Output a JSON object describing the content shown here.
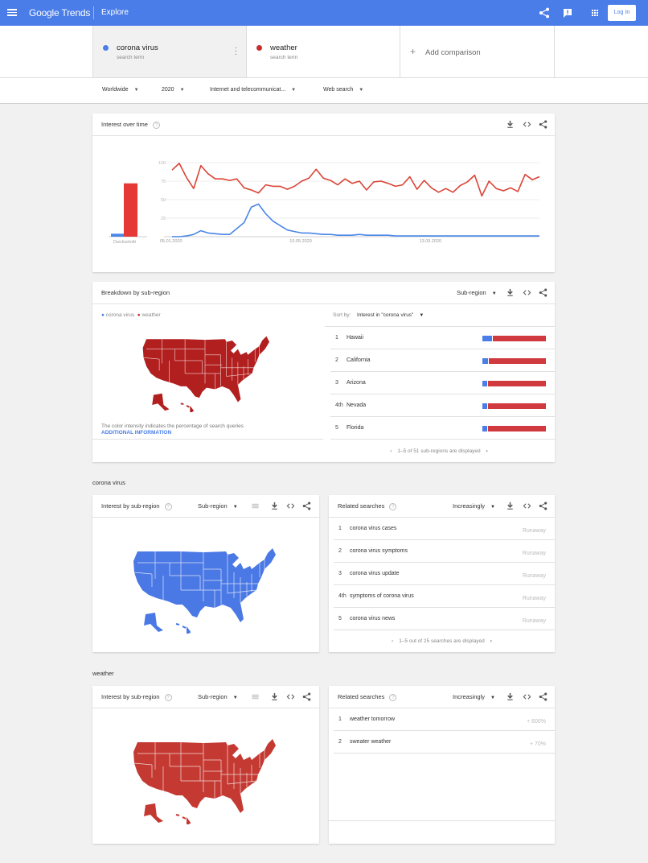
{
  "topbar": {
    "app_title": "Google Trends",
    "page": "Explore",
    "login_label": "Log In",
    "icons": [
      "menu-icon",
      "share-icon",
      "feedback-icon",
      "apps-icon"
    ]
  },
  "terms": [
    {
      "name": "corona virus",
      "sub": "search term",
      "color": "#4a7de8"
    },
    {
      "name": "weather",
      "sub": "search term",
      "color": "#c62e2e"
    }
  ],
  "add_comparison": "Add comparison",
  "filters": [
    {
      "label": "Worldwide"
    },
    {
      "label": "2020"
    },
    {
      "label": "Internet and telecommunicat..."
    },
    {
      "label": "Web search"
    }
  ],
  "interest_over_time": {
    "title": "Interest over time",
    "avg_label": "Durchschnitt"
  },
  "chart_data": {
    "type": "line",
    "title": "Interest over time",
    "ylim": [
      0,
      100
    ],
    "yticks": [
      "100",
      "75",
      "50",
      "25"
    ],
    "xticks": [
      "05.01.2020",
      "10.05.2020",
      "13.09.2020"
    ],
    "grid": true,
    "series": [
      {
        "name": "corona virus",
        "color": "#4a86e8",
        "values": [
          0,
          0,
          1,
          3,
          8,
          5,
          4,
          3,
          3,
          11,
          19,
          40,
          44,
          31,
          21,
          15,
          9,
          7,
          5,
          5,
          4,
          3,
          3,
          2,
          2,
          2,
          3,
          2,
          2,
          2,
          2,
          1,
          1,
          1,
          1,
          1,
          1,
          1,
          1,
          1,
          1,
          1,
          1,
          1,
          1,
          1,
          1,
          1,
          1,
          1,
          1,
          1
        ],
        "average": 4
      },
      {
        "name": "weather",
        "color": "#db4437",
        "values": [
          90,
          99,
          80,
          65,
          96,
          85,
          78,
          78,
          76,
          78,
          66,
          63,
          59,
          70,
          68,
          68,
          64,
          68,
          75,
          79,
          91,
          79,
          76,
          70,
          78,
          72,
          75,
          63,
          74,
          75,
          72,
          68,
          70,
          81,
          64,
          76,
          66,
          60,
          65,
          60,
          69,
          74,
          83,
          55,
          75,
          65,
          62,
          66,
          61,
          84,
          77,
          81
        ],
        "average": 72
      }
    ]
  },
  "breakdown": {
    "title": "Breakdown by sub-region",
    "select_label": "Sub-region",
    "legend": [
      "corona virus",
      "weather"
    ],
    "sort_label": "Sort by:",
    "sort_value": "Interest in \"corona virus\"",
    "note": "The color intensity indicates the percentage of search queries",
    "additional_info": "ADDITIONAL INFORMATION",
    "rows": [
      {
        "rank": "1",
        "name": "Hawaii",
        "corona_pct": 15,
        "weather_pct": 85
      },
      {
        "rank": "2",
        "name": "California",
        "corona_pct": 9,
        "weather_pct": 91
      },
      {
        "rank": "3",
        "name": "Arizona",
        "corona_pct": 8,
        "weather_pct": 92
      },
      {
        "rank": "4th",
        "name": "Nevada",
        "corona_pct": 8,
        "weather_pct": 92
      },
      {
        "rank": "5",
        "name": "Florida",
        "corona_pct": 8,
        "weather_pct": 92
      }
    ],
    "pager": "1–5 of 51 sub-regions are displayed"
  },
  "corona_section": {
    "label": "corona virus",
    "interest_title": "Interest by sub-region",
    "select_label": "Sub-region",
    "related_title": "Related searches",
    "related_select": "Increasingly",
    "related": [
      {
        "rank": "1",
        "query": "corona virus cases",
        "value": "Runaway"
      },
      {
        "rank": "2",
        "query": "corona virus symptoms",
        "value": "Runaway"
      },
      {
        "rank": "3",
        "query": "corona virus update",
        "value": "Runaway"
      },
      {
        "rank": "4th",
        "query": "symptoms of corona virus",
        "value": "Runaway"
      },
      {
        "rank": "5",
        "query": "corona virus news",
        "value": "Runaway"
      }
    ],
    "pager": "1–5 out of 25 searches are displayed"
  },
  "weather_section": {
    "label": "weather",
    "interest_title": "Interest by sub-region",
    "select_label": "Sub-region",
    "related_title": "Related searches",
    "related_select": "Increasingly",
    "related": [
      {
        "rank": "1",
        "query": "weather tomorrow",
        "value": "+ 600%"
      },
      {
        "rank": "2",
        "query": "sweater weather",
        "value": "+ 70%"
      }
    ]
  }
}
